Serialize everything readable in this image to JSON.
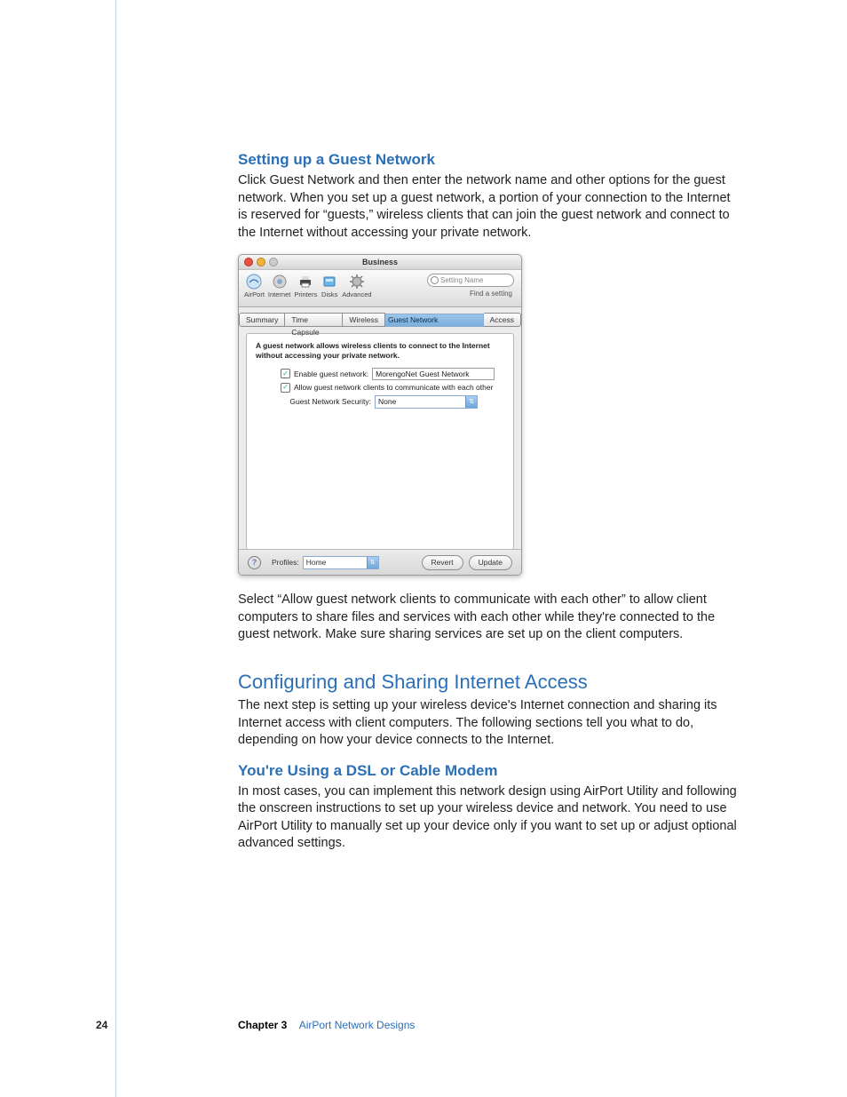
{
  "headings": {
    "h3a": "Setting up a Guest Network",
    "h2": "Configuring and Sharing Internet Access",
    "h3b": "You're Using a DSL or Cable Modem"
  },
  "paras": {
    "p1": "Click Guest Network and then enter the network name and other options for the guest network. When you set up a guest network, a portion of your connection to the Internet is reserved for “guests,” wireless clients that can join the guest network and connect to the Internet without accessing your private network.",
    "p2": "Select “Allow guest network clients to communicate with each other” to allow client computers to share files and services with each other while they're connected to the guest network. Make sure sharing services are set up on the client computers.",
    "p3": "The next step is setting up your wireless device's Internet connection and sharing its Internet access with client computers. The following sections tell you what to do, depending on how your device connects to the Internet.",
    "p4": "In most cases, you can implement this network design using AirPort Utility and following the onscreen instructions to set up your wireless device and network. You need to use AirPort Utility to manually set up your device only if you want to set up or adjust optional advanced settings."
  },
  "footer": {
    "page": "24",
    "chapter_label": "Chapter 3",
    "chapter_title": "AirPort Network Designs"
  },
  "window": {
    "title": "Business",
    "search_placeholder": "Setting Name",
    "find_label": "Find a setting",
    "toolbar": {
      "airport": "AirPort",
      "internet": "Internet",
      "printers": "Printers",
      "disks": "Disks",
      "advanced": "Advanced"
    },
    "tabs": {
      "summary": "Summary",
      "timecapsule": "Time Capsule",
      "wireless": "Wireless",
      "guest": "Guest Network",
      "access": "Access"
    },
    "pane": {
      "desc": "A guest network allows wireless clients to connect to the Internet without accessing your private network.",
      "enable_label": "Enable guest network:",
      "network_name": "MorengoNet Guest Network",
      "allow_label": "Allow guest network clients to communicate with each other",
      "security_label": "Guest Network Security:",
      "security_value": "None"
    },
    "bottom": {
      "profiles_label": "Profiles:",
      "profiles_value": "Home",
      "revert": "Revert",
      "update": "Update"
    }
  }
}
